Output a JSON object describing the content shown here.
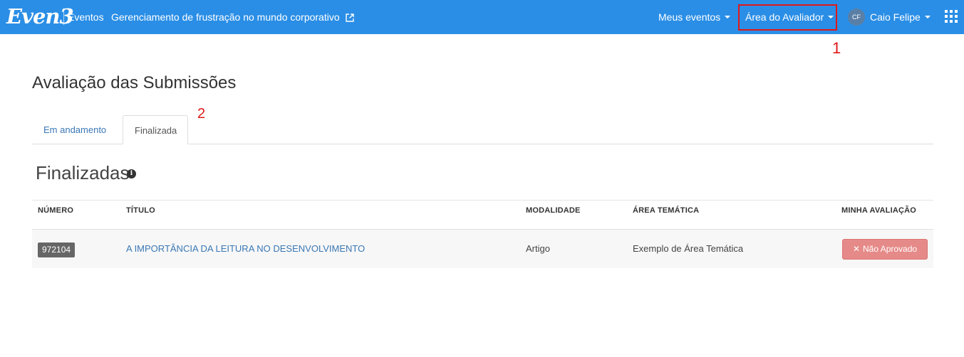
{
  "navbar": {
    "logo": "Even3",
    "brand_sub": "Eventos",
    "event_title": "Gerenciamento de frustração no mundo corporativo",
    "meus_eventos": "Meus eventos",
    "area_avaliador": "Área do Avaliador",
    "user_initials": "CF",
    "user_name": "Caio Felipe",
    "colors": {
      "bar": "#2a8ee6",
      "highlight": "#e01818"
    }
  },
  "annotations": {
    "one": "1",
    "two": "2"
  },
  "page": {
    "title": "Avaliação das Submissões",
    "tabs": [
      {
        "label": "Em andamento",
        "active": false
      },
      {
        "label": "Finalizada",
        "active": true
      }
    ],
    "section_title": "Finalizadas"
  },
  "table": {
    "headers": [
      "NÚMERO",
      "TÍTULO",
      "MODALIDADE",
      "ÁREA TEMÁTICA",
      "MINHA AVALIAÇÃO"
    ],
    "rows": [
      {
        "numero": "972104",
        "titulo": "A IMPORTÂNCIA DA LEITURA NO DESENVOLVIMENTO",
        "modalidade": "Artigo",
        "area": "Exemplo de Área Temática",
        "avaliacao": "Não Aprovado"
      }
    ],
    "status_color": "#e58a88"
  }
}
